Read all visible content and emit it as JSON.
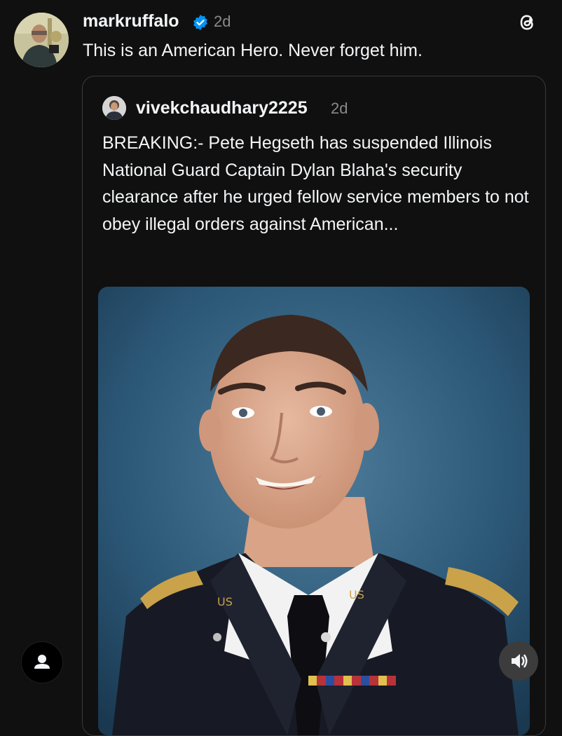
{
  "post": {
    "author": "markruffalo",
    "verified_badge": "verified-badge-icon",
    "time": "2d",
    "text": "This is an American Hero. Never forget him."
  },
  "quoted_post": {
    "author": "vivekchaudhary2225",
    "time": "2d",
    "text": "BREAKING:- Pete Hegseth has suspended Illinois National Guard Captain Dylan Blaha's security clearance after he urged fellow service members to not obey illegal orders against American..."
  },
  "icons": {
    "app_logo": "threads-logo-icon",
    "profile": "person-icon",
    "volume": "speaker-volume-icon"
  },
  "colors": {
    "background": "#101010",
    "text": "#f3f5f7",
    "muted": "#8a8a8a",
    "verified": "#0095f6",
    "card_border": "#3a3a3a"
  }
}
